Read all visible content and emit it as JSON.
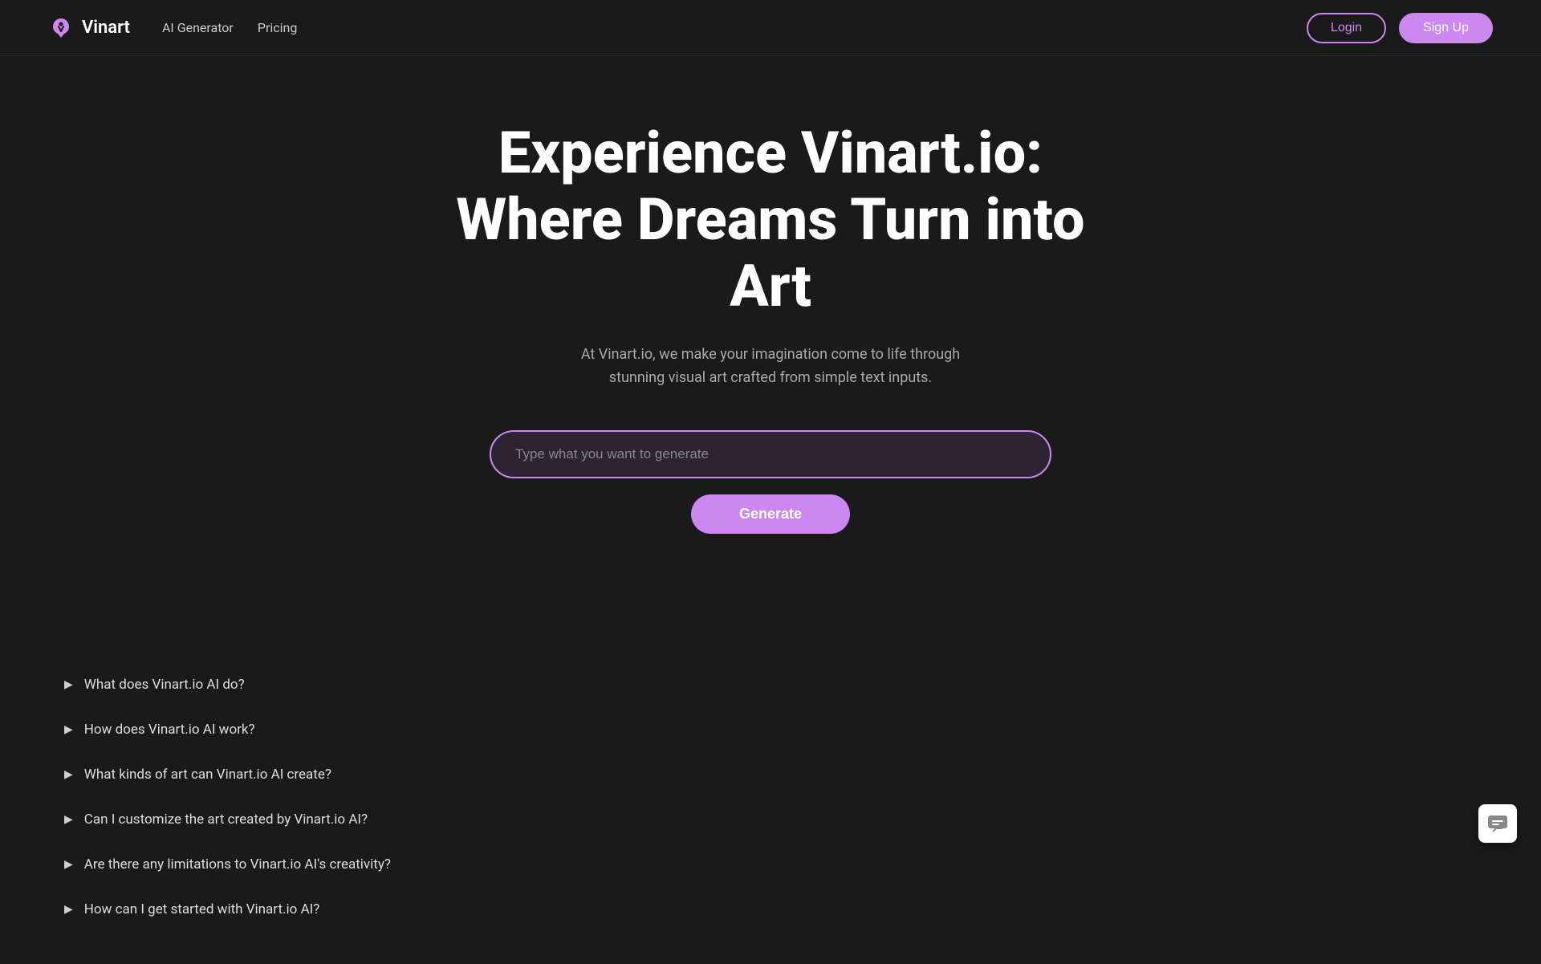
{
  "brand": {
    "name": "Vinart",
    "logo_alt": "Vinart logo"
  },
  "nav": {
    "links": [
      {
        "label": "AI Generator",
        "id": "ai-generator"
      },
      {
        "label": "Pricing",
        "id": "pricing"
      }
    ],
    "login_label": "Login",
    "signup_label": "Sign Up"
  },
  "hero": {
    "title": "Experience Vinart.io: Where Dreams Turn into Art",
    "subtitle": "At Vinart.io, we make your imagination come to life through stunning visual art crafted from simple text inputs.",
    "input_placeholder": "Type what you want to generate",
    "generate_label": "Generate"
  },
  "faq": {
    "items": [
      {
        "question": "What does Vinart.io AI do?"
      },
      {
        "question": "How does Vinart.io AI work?"
      },
      {
        "question": "What kinds of art can Vinart.io AI create?"
      },
      {
        "question": "Can I customize the art created by Vinart.io AI?"
      },
      {
        "question": "Are there any limitations to Vinart.io AI's creativity?"
      },
      {
        "question": "How can I get started with Vinart.io AI?"
      }
    ]
  },
  "colors": {
    "accent": "#cc88ee",
    "bg": "#1a1a1a",
    "input_bg": "#2d2433"
  }
}
